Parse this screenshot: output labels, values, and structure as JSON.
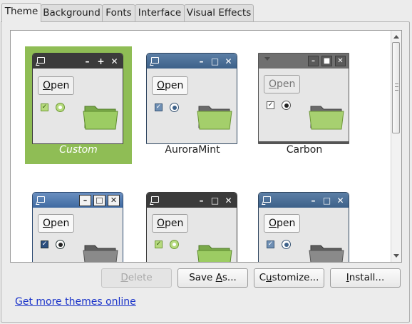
{
  "tabs": [
    {
      "label": "Theme",
      "active": true
    },
    {
      "label": "Background",
      "active": false
    },
    {
      "label": "Fonts",
      "active": false
    },
    {
      "label": "Interface",
      "active": false
    },
    {
      "label": "Visual Effects",
      "active": false
    }
  ],
  "themes": [
    {
      "name": "Custom",
      "selected": true,
      "preview": {
        "button": "Open",
        "button_mnemonic": "O",
        "controls": [
          "minimize",
          "maximize",
          "close"
        ],
        "checkbox_checked": true,
        "radio_checked": true,
        "folder_icon": "green-folder-icon",
        "title_color": "#3b3b3b"
      }
    },
    {
      "name": "AuroraMint",
      "selected": false,
      "preview": {
        "button": "Open",
        "button_mnemonic": "O",
        "controls": [
          "minimize",
          "maximize",
          "close"
        ],
        "checkbox_checked": true,
        "radio_checked": true,
        "folder_icon": "green-folder-icon",
        "title_color": "#4a6f9a"
      }
    },
    {
      "name": "Carbon",
      "selected": false,
      "preview": {
        "button": "Open",
        "button_mnemonic": "O",
        "controls": [
          "minimize",
          "maximize",
          "close"
        ],
        "checkbox_checked": true,
        "radio_checked": true,
        "folder_icon": "green-folder-icon",
        "title_color": "#6f6f6f"
      }
    },
    {
      "name": "",
      "selected": false,
      "preview": {
        "button": "Open",
        "button_mnemonic": "O",
        "controls": [
          "minimize",
          "maximize",
          "close"
        ],
        "checkbox_checked": true,
        "radio_checked": true,
        "folder_icon": "gray-folder-icon",
        "title_color": "#3f6aa1"
      }
    },
    {
      "name": "",
      "selected": false,
      "preview": {
        "button": "Open",
        "button_mnemonic": "O",
        "controls": [
          "minimize",
          "maximize",
          "close"
        ],
        "checkbox_checked": true,
        "radio_checked": true,
        "folder_icon": "green-folder-icon",
        "title_color": "#3b3b3b"
      }
    },
    {
      "name": "",
      "selected": false,
      "preview": {
        "button": "Open",
        "button_mnemonic": "O",
        "controls": [
          "minimize",
          "maximize",
          "close"
        ],
        "checkbox_checked": true,
        "radio_checked": true,
        "folder_icon": "gray-folder-icon",
        "title_color": "#4a6f9a"
      }
    }
  ],
  "buttons": {
    "delete": {
      "pre": "",
      "mn": "D",
      "post": "elete",
      "enabled": false
    },
    "save_as": {
      "pre": "Save ",
      "mn": "A",
      "post": "s...",
      "enabled": true
    },
    "customize": {
      "pre": "C",
      "mn": "u",
      "post": "stomize...",
      "enabled": true
    },
    "install": {
      "pre": "",
      "mn": "I",
      "post": "nstall...",
      "enabled": true
    }
  },
  "link": {
    "label": "Get more themes online"
  },
  "colors": {
    "selection": "#8fbd55",
    "link": "#1a33c9"
  }
}
